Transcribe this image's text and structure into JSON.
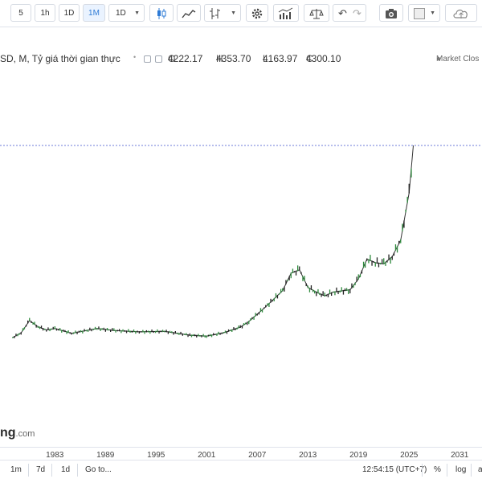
{
  "toolbar": {
    "intervals": [
      "5",
      "1h",
      "1D",
      "1M",
      "1D"
    ],
    "active_interval": "1M"
  },
  "legend": {
    "symbol_fragment": "SD, M, Tỷ giá thời gian thực",
    "open_label": "O",
    "open": "4222.17",
    "high_label": "H",
    "high": "4353.70",
    "low_label": "L",
    "low": "4163.97",
    "close_label": "C",
    "close": "4300.10",
    "status": "Market Clos"
  },
  "watermark": {
    "main": "ng",
    "suffix": ".com"
  },
  "xaxis": {
    "ticks": [
      "1983",
      "1989",
      "1995",
      "2001",
      "2007",
      "2013",
      "2019",
      "2025",
      "2031"
    ]
  },
  "bottombar": {
    "ranges": [
      "1m",
      "7d",
      "1d"
    ],
    "goto": "Go to...",
    "time": "12:54:15 (UTC+7)",
    "percent": "%",
    "log": "log",
    "auto_fragment": "a"
  },
  "chart_data": {
    "type": "line",
    "x": [
      1978,
      1979,
      1980,
      1981,
      1982,
      1983,
      1985,
      1988,
      1990,
      1993,
      1996,
      1999,
      2001,
      2003,
      2005,
      2006,
      2008,
      2010,
      2011,
      2012,
      2013,
      2014,
      2015,
      2016,
      2018,
      2019,
      2020,
      2021,
      2022,
      2023,
      2024,
      2025,
      2025.5
    ],
    "values": [
      240,
      340,
      600,
      470,
      400,
      430,
      330,
      430,
      390,
      360,
      370,
      290,
      270,
      340,
      460,
      580,
      890,
      1230,
      1600,
      1670,
      1300,
      1200,
      1120,
      1200,
      1250,
      1480,
      1900,
      1820,
      1800,
      1950,
      2300,
      3300,
      4300
    ],
    "ohlc_last": {
      "open": 4222.17,
      "high": 4353.7,
      "low": 4163.97,
      "close": 4300.1
    },
    "xlabel": "",
    "ylabel": "",
    "grid": false
  }
}
